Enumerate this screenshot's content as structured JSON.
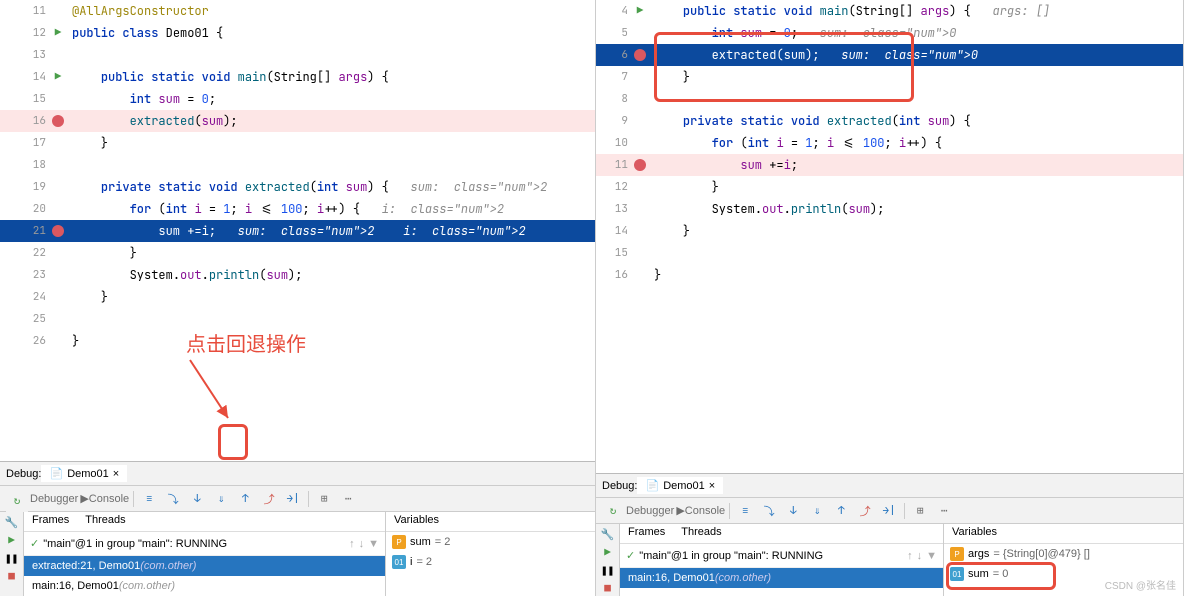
{
  "left": {
    "lines": [
      {
        "n": "11",
        "icon": "",
        "code": "@AllArgsConstructor",
        "cls": "anno"
      },
      {
        "n": "12",
        "icon": "run",
        "code": "public class Demo01 {",
        "cls": ""
      },
      {
        "n": "13",
        "icon": "",
        "code": "",
        "cls": ""
      },
      {
        "n": "14",
        "icon": "run",
        "code": "    public static void main(String[] args) {",
        "cls": ""
      },
      {
        "n": "15",
        "icon": "",
        "code": "        int sum = 0;",
        "cls": ""
      },
      {
        "n": "16",
        "icon": "bp",
        "code": "        extracted(sum);",
        "cls": "hl-bp"
      },
      {
        "n": "17",
        "icon": "",
        "code": "    }",
        "cls": ""
      },
      {
        "n": "18",
        "icon": "",
        "code": "",
        "cls": ""
      },
      {
        "n": "19",
        "icon": "",
        "code": "    private static void extracted(int sum) {   sum: 2",
        "cls": ""
      },
      {
        "n": "20",
        "icon": "",
        "code": "        for (int i = 1; i <= 100; i++) {   i: 2",
        "cls": ""
      },
      {
        "n": "21",
        "icon": "bp",
        "code": "            sum +=i;   sum: 2    i: 2",
        "cls": "hl-exec"
      },
      {
        "n": "22",
        "icon": "",
        "code": "        }",
        "cls": ""
      },
      {
        "n": "23",
        "icon": "",
        "code": "        System.out.println(sum);",
        "cls": ""
      },
      {
        "n": "24",
        "icon": "",
        "code": "    }",
        "cls": ""
      },
      {
        "n": "25",
        "icon": "",
        "code": "",
        "cls": ""
      },
      {
        "n": "26",
        "icon": "",
        "code": "}",
        "cls": ""
      }
    ],
    "annotation": "点击回退操作",
    "debug": {
      "tab": "Demo01",
      "debugger": "Debugger",
      "console": "Console",
      "framesLabel": "Frames",
      "threadsLabel": "Threads",
      "varsLabel": "Variables",
      "thread": "\"main\"@1 in group \"main\": RUNNING",
      "frames": [
        {
          "text": "extracted:21, Demo01 ",
          "pkg": "(com.other)",
          "sel": true
        },
        {
          "text": "main:16, Demo01 ",
          "pkg": "(com.other)",
          "sel": false
        }
      ],
      "vars": [
        {
          "badge": "p",
          "name": "sum",
          "val": " = 2"
        },
        {
          "badge": "i",
          "name": "i",
          "val": " = 2"
        }
      ]
    },
    "debugLabel": "Debug:"
  },
  "right": {
    "lines": [
      {
        "n": "4",
        "icon": "run",
        "code": "    public static void main(String[] args) {   args: []",
        "cls": ""
      },
      {
        "n": "5",
        "icon": "",
        "code": "        int sum = 0;   sum: 0",
        "cls": ""
      },
      {
        "n": "6",
        "icon": "bp",
        "code": "        extracted(sum);   sum: 0",
        "cls": "hl-exec"
      },
      {
        "n": "7",
        "icon": "",
        "code": "    }",
        "cls": ""
      },
      {
        "n": "8",
        "icon": "",
        "code": "",
        "cls": ""
      },
      {
        "n": "9",
        "icon": "",
        "code": "    private static void extracted(int sum) {",
        "cls": ""
      },
      {
        "n": "10",
        "icon": "",
        "code": "        for (int i = 1; i <= 100; i++) {",
        "cls": ""
      },
      {
        "n": "11",
        "icon": "bp",
        "code": "            sum +=i;",
        "cls": "hl-bp"
      },
      {
        "n": "12",
        "icon": "",
        "code": "        }",
        "cls": ""
      },
      {
        "n": "13",
        "icon": "",
        "code": "        System.out.println(sum);",
        "cls": ""
      },
      {
        "n": "14",
        "icon": "",
        "code": "    }",
        "cls": ""
      },
      {
        "n": "15",
        "icon": "",
        "code": "",
        "cls": ""
      },
      {
        "n": "16",
        "icon": "",
        "code": "}",
        "cls": ""
      }
    ],
    "debug": {
      "tab": "Demo01",
      "debugger": "Debugger",
      "console": "Console",
      "framesLabel": "Frames",
      "threadsLabel": "Threads",
      "varsLabel": "Variables",
      "thread": "\"main\"@1 in group \"main\": RUNNING",
      "frames": [
        {
          "text": "main:16, Demo01 ",
          "pkg": "(com.other)",
          "sel": true
        }
      ],
      "vars": [
        {
          "badge": "p",
          "name": "args",
          "val": " = {String[0]@479} []"
        },
        {
          "badge": "i",
          "name": "sum",
          "val": " = 0"
        }
      ]
    },
    "debugLabel": "Debug:"
  },
  "watermark": "CSDN @张名佳"
}
